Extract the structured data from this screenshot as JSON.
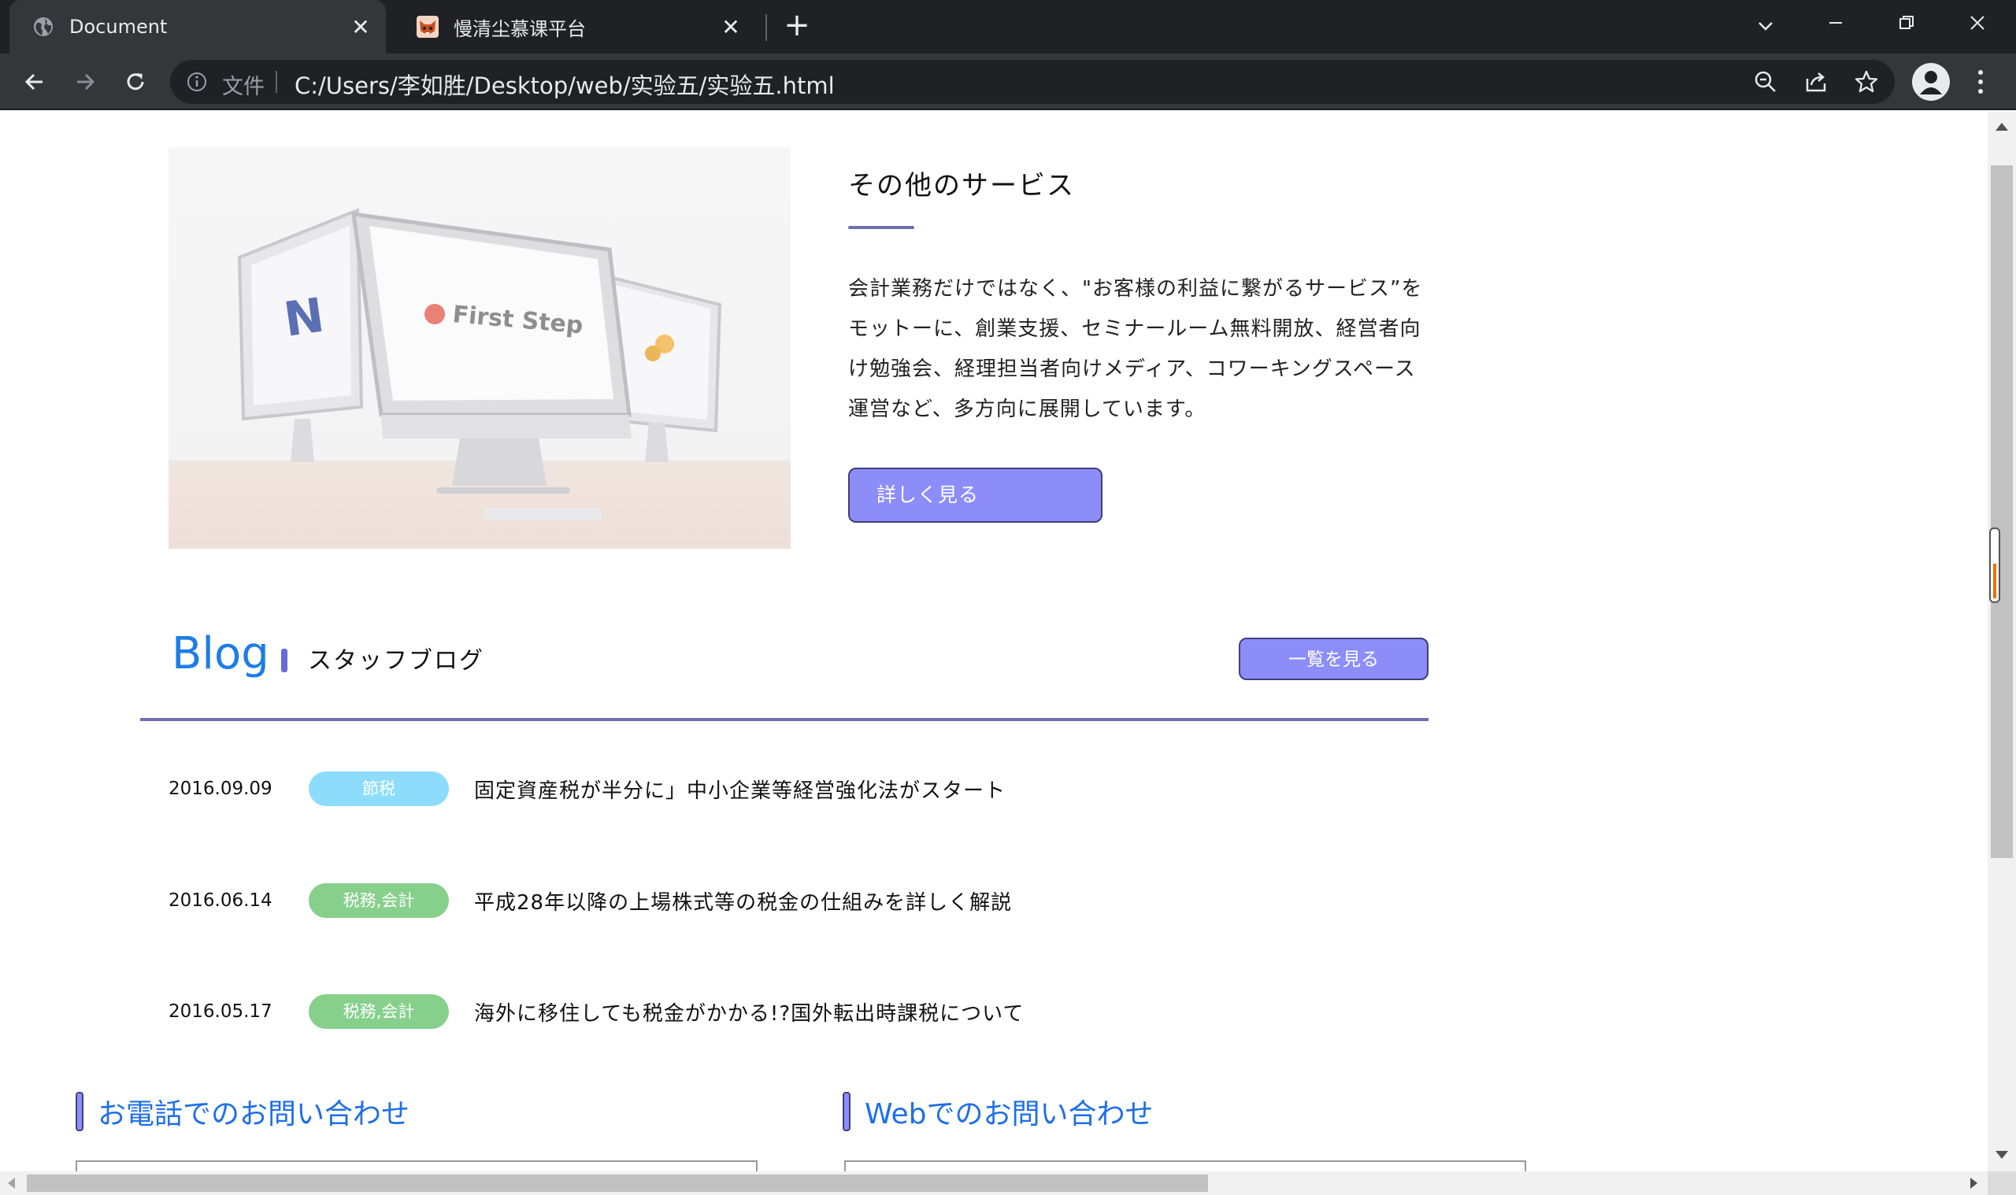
{
  "browser": {
    "tabs": [
      {
        "title": "Document",
        "active": true,
        "favicon": "globe-icon"
      },
      {
        "title": "慢清尘慕课平台",
        "active": false,
        "favicon": "fox-icon"
      }
    ],
    "address": {
      "scheme_label": "文件",
      "url": "C:/Users/李如胜/Desktop/web/实验五/实验五.html"
    }
  },
  "service": {
    "image_text": "First Step",
    "title": "その他のサービス",
    "body": "会計業務だけではなく、\"お客様の利益に繋がるサービス”をモットーに、創業支援、セミナールーム無料開放、経営者向け勉強会、経理担当者向けメディア、コワーキングスペース運営など、多方向に展開しています。",
    "button_label": "詳しく見る"
  },
  "blog": {
    "heading": "Blog",
    "subheading": "スタッフブログ",
    "all_button_label": "一覧を見る",
    "posts": [
      {
        "date": "2016.09.09",
        "tag": "節税",
        "tag_color": "#8ddcfb",
        "title": "固定資産税が半分に」中小企業等経営強化法がスタート"
      },
      {
        "date": "2016.06.14",
        "tag": "税務,会計",
        "tag_color": "#86d08c",
        "title": "平成28年以降の上場株式等の税金の仕組みを詳しく解説"
      },
      {
        "date": "2016.05.17",
        "tag": "税務,会計",
        "tag_color": "#86d08c",
        "title": "海外に移住しても税金がかかる!?国外転出時課税について"
      }
    ]
  },
  "contact": {
    "phone_heading": "お電話でのお問い合わせ",
    "web_heading": "Webでのお問い合わせ"
  },
  "colors": {
    "accent_button": "#8d8dfa",
    "blog_heading": "#1e7de6",
    "contact_heading": "#1e6fe8"
  }
}
